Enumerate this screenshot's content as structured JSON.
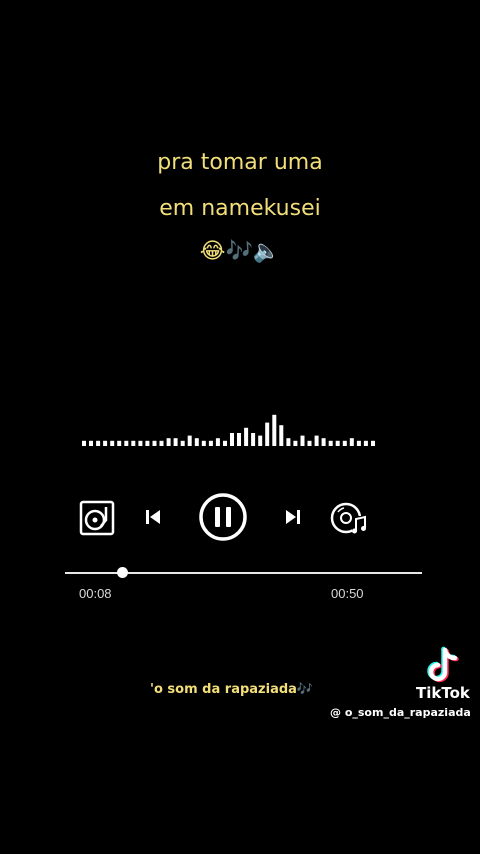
{
  "lyrics": {
    "line1": "pra tomar uma",
    "line2": "em namekusei",
    "emojis": "😂🎶🔈"
  },
  "player": {
    "elapsed": "00:08",
    "total": "00:50",
    "progress_fraction": 0.16,
    "waveform_levels": [
      2,
      2,
      2,
      2,
      2,
      2,
      2,
      2,
      2,
      2,
      2,
      2,
      3,
      3,
      2,
      4,
      3,
      2,
      2,
      3,
      2,
      5,
      5,
      7,
      5,
      4,
      9,
      12,
      8,
      3,
      2,
      4,
      2,
      4,
      3,
      2,
      2,
      2,
      3,
      2,
      2,
      2
    ],
    "icons": {
      "left": "turntable-icon",
      "prev": "skip-previous-icon",
      "play_state": "pause-icon",
      "next": "skip-next-icon",
      "right": "music-disc-icon"
    },
    "accent": "#ffffff"
  },
  "caption": {
    "text": "'o som da rapaziada🎶"
  },
  "watermark": {
    "brand": "TikTok",
    "handle": "@ o_som_da_rapaziada"
  },
  "colors": {
    "lyric_color": "#f2df7a",
    "background": "#000000"
  }
}
